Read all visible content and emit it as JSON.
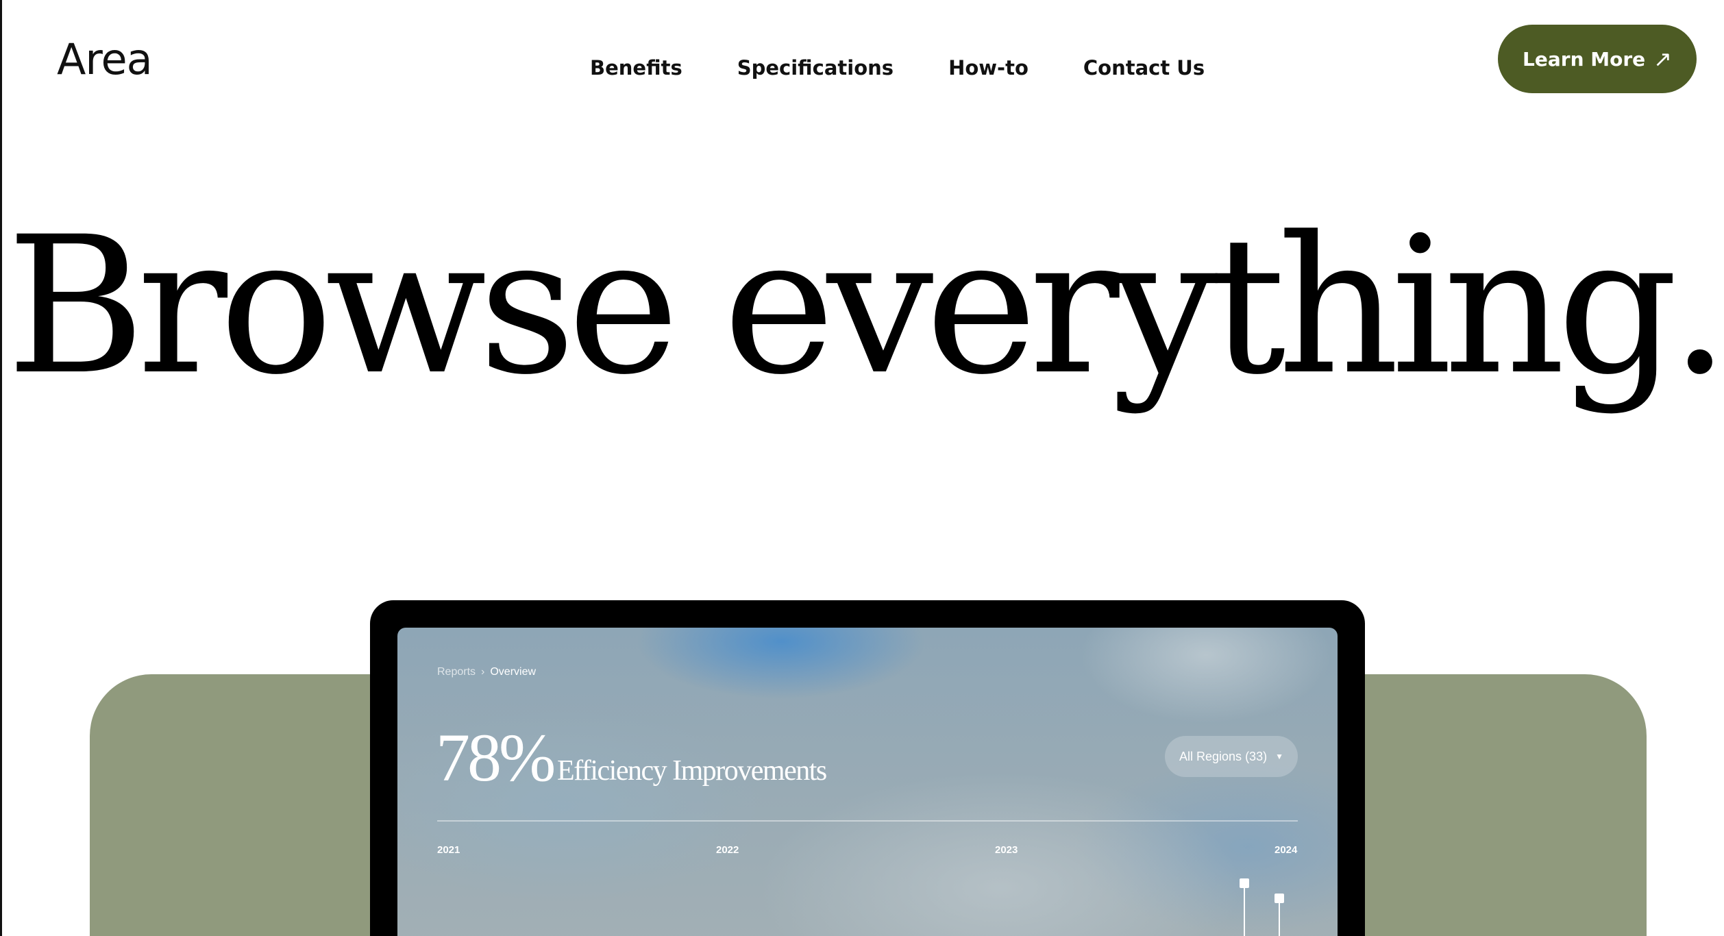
{
  "header": {
    "logo": "Area",
    "nav": [
      "Benefits",
      "Specifications",
      "How-to",
      "Contact Us"
    ],
    "cta_label": "Learn More",
    "cta_icon": "arrow-up-right-icon"
  },
  "hero": {
    "title": "Browse everything."
  },
  "colors": {
    "accent": "#4d5b24",
    "panel": "#909a7d"
  },
  "dashboard": {
    "breadcrumb": {
      "parent": "Reports",
      "current": "Overview"
    },
    "stat_value": "78%",
    "stat_label": "Efficiency Improvements",
    "region_select": "All Regions (33)",
    "years": [
      "2021",
      "2022",
      "2023",
      "2024"
    ]
  }
}
